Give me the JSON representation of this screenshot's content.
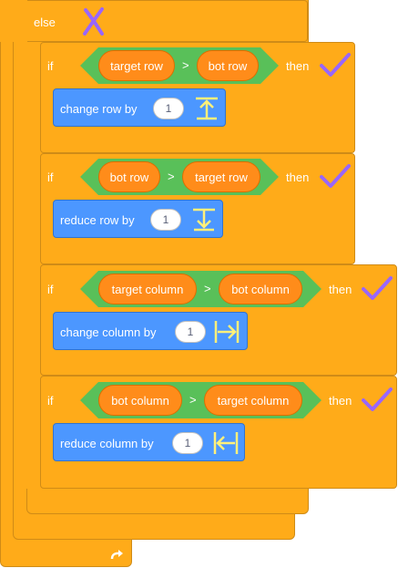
{
  "else_label": "else",
  "if_label": "if",
  "then_label": "then",
  "greater_than": ">",
  "colors": {
    "control": "#ffab19",
    "control_border": "#cf8b17",
    "operator": "#59c059",
    "reporter": "#ff8c1a",
    "motion": "#4c97ff",
    "check": "#9966ff",
    "cross": "#9966ff",
    "arrow_icon": "#fff07a"
  },
  "blocks": [
    {
      "left": "target row",
      "right": "bot row",
      "action": "change row by",
      "value": "1",
      "icon": "arrow-up-to-bar-icon"
    },
    {
      "left": "bot row",
      "right": "target row",
      "action": "reduce row by",
      "value": "1",
      "icon": "arrow-down-to-bar-icon"
    },
    {
      "left": "target column",
      "right": "bot column",
      "action": "change column by",
      "value": "1",
      "icon": "arrow-right-to-bar-icon"
    },
    {
      "left": "bot column",
      "right": "target column",
      "action": "reduce column by",
      "value": "1",
      "icon": "arrow-left-to-bar-icon"
    }
  ],
  "cross_icon": "cross-mark-icon",
  "check_icon": "check-mark-icon",
  "repeat_icon": "loop-arrow-icon"
}
